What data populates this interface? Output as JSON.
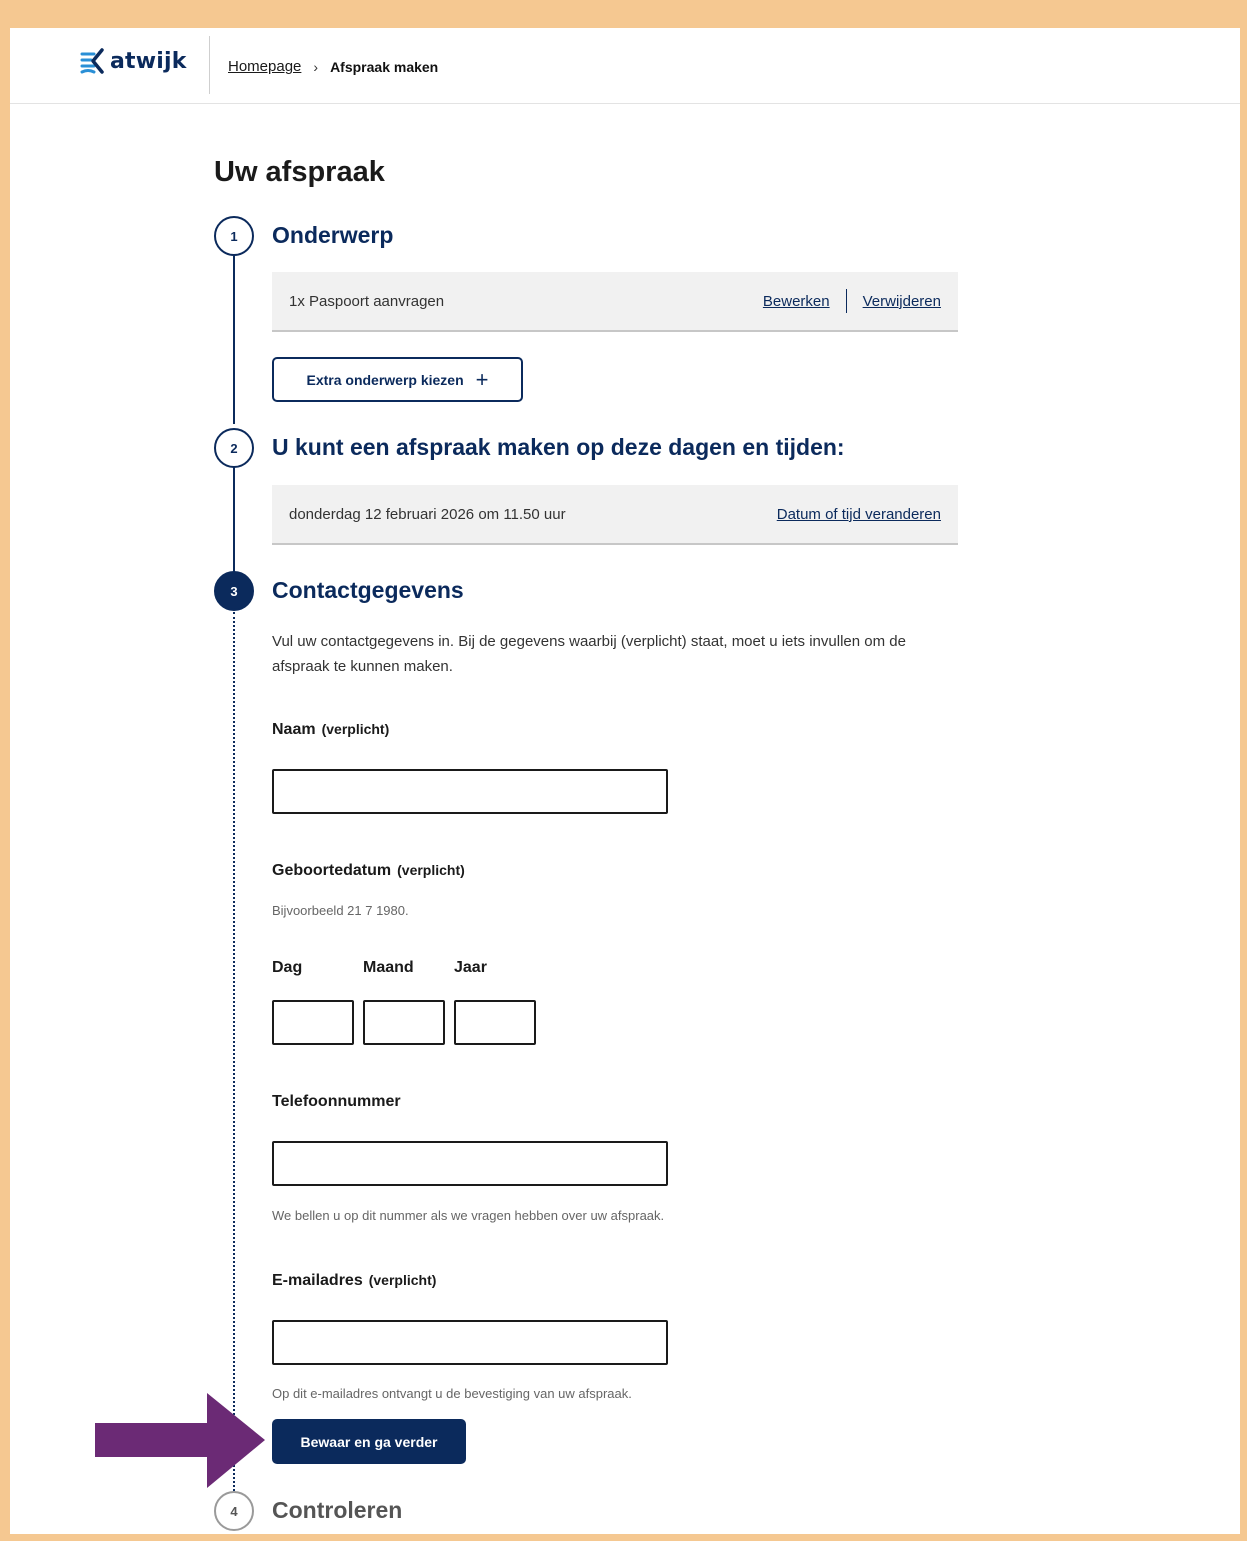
{
  "header": {
    "logo_text": "atwijk",
    "breadcrumb": {
      "home": "Homepage",
      "separator": "›",
      "current": "Afspraak maken"
    }
  },
  "page_title": "Uw afspraak",
  "steps": [
    {
      "number": "1",
      "title": "Onderwerp",
      "state": "done"
    },
    {
      "number": "2",
      "title": "U kunt een afspraak maken op deze dagen en tijden:",
      "state": "done"
    },
    {
      "number": "3",
      "title": "Contactgegevens",
      "state": "active"
    },
    {
      "number": "4",
      "title": "Controleren",
      "state": "pending"
    }
  ],
  "subject": {
    "item": "1x Paspoort aanvragen",
    "edit_link": "Bewerken",
    "remove_link": "Verwijderen",
    "add_button": "Extra onderwerp kiezen",
    "add_icon": "+"
  },
  "appointment": {
    "datetime": "donderdag 12 februari 2026 om 11.50 uur",
    "change_link": "Datum of tijd veranderen"
  },
  "contact": {
    "intro": "Vul uw contactgegevens in. Bij de gegevens waarbij (verplicht) staat, moet u iets invullen om de afspraak te kunnen maken.",
    "required_tag": "(verplicht)",
    "name": {
      "label": "Naam",
      "value": ""
    },
    "birthdate": {
      "label": "Geboortedatum",
      "hint": "Bijvoorbeeld 21 7 1980.",
      "day_label": "Dag",
      "month_label": "Maand",
      "year_label": "Jaar",
      "day_value": "",
      "month_value": "",
      "year_value": ""
    },
    "phone": {
      "label": "Telefoonnummer",
      "value": "",
      "hint": "We bellen u op dit nummer als we vragen hebben over uw afspraak."
    },
    "email": {
      "label": "E-mailadres",
      "value": "",
      "hint": "Op dit e-mailadres ontvangt u de bevestiging van uw afspraak."
    },
    "submit_button": "Bewaar en ga verder"
  },
  "colors": {
    "brand": "#0b2a5c",
    "frame_background": "#f5c891",
    "annotation_arrow": "#6b2a75"
  },
  "icons": {
    "logo": "katwijk-waves-logo",
    "annotation": "arrow-right-icon"
  }
}
